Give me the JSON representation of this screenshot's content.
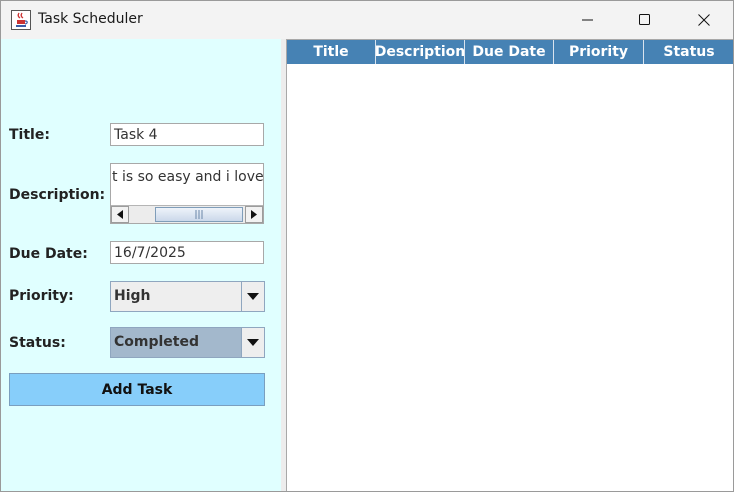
{
  "window": {
    "title": "Task Scheduler",
    "icon": "java-cup-icon",
    "controls": [
      "minimize-icon",
      "maximize-icon",
      "close-icon"
    ]
  },
  "form": {
    "title_label": "Title:",
    "title_value": "Task 4",
    "description_label": "Description:",
    "description_value": "t is so easy and i love it",
    "due_date_label": "Due Date:",
    "due_date_value": "16/7/2025",
    "priority_label": "Priority:",
    "priority_value": "High",
    "status_label": "Status:",
    "status_value": "Completed",
    "add_button": "Add Task"
  },
  "table": {
    "columns": [
      "Title",
      "Description",
      "Due Date",
      "Priority",
      "Status"
    ],
    "rows": []
  },
  "colors": {
    "form_background": "#e0ffff",
    "table_header": "#4682b4",
    "add_button": "#87cefa",
    "status_combo": "#a3b8cc"
  }
}
